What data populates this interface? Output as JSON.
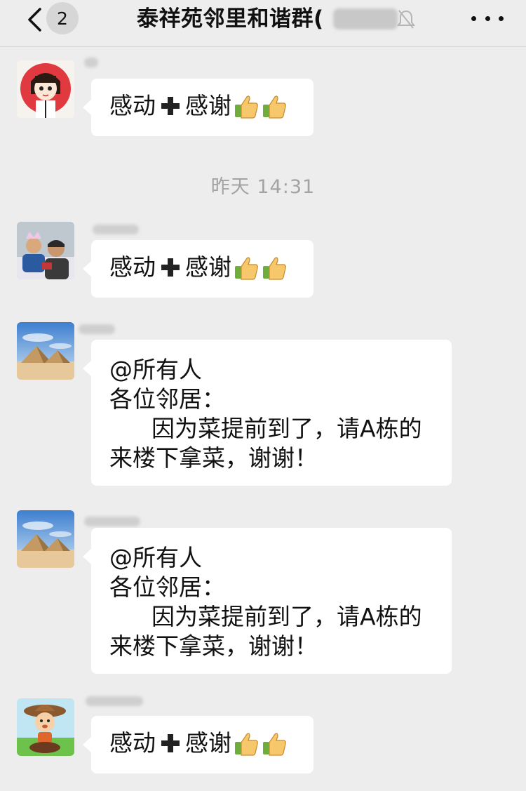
{
  "header": {
    "unread_count": "2",
    "title": "泰祥苑邻里和谐群("
  },
  "timestamp": "昨天 14:31",
  "messages": [
    {
      "text_a": "感动",
      "text_b": "感谢",
      "avatar": "girl-cartoon-avatar"
    },
    {
      "text_a": "感动",
      "text_b": "感谢",
      "avatar": "group-photo-avatar"
    },
    {
      "line1": "@所有人",
      "line2": "各位邻居：",
      "line3": "因为菜提前到了，请A栋的",
      "line4": "来楼下拿菜，谢谢！",
      "avatar": "pyramids-avatar"
    },
    {
      "line1": "@所有人",
      "line2": "各位邻居：",
      "line3": "因为菜提前到了，请A栋的",
      "line4": "来楼下拿菜，谢谢！",
      "avatar": "pyramids-avatar"
    },
    {
      "text_a": "感动",
      "text_b": "感谢",
      "avatar": "cowboy-cartoon-avatar"
    }
  ],
  "colors": {
    "background": "#ededed",
    "bubble": "#ffffff",
    "timestamp": "#a3a3a3"
  }
}
